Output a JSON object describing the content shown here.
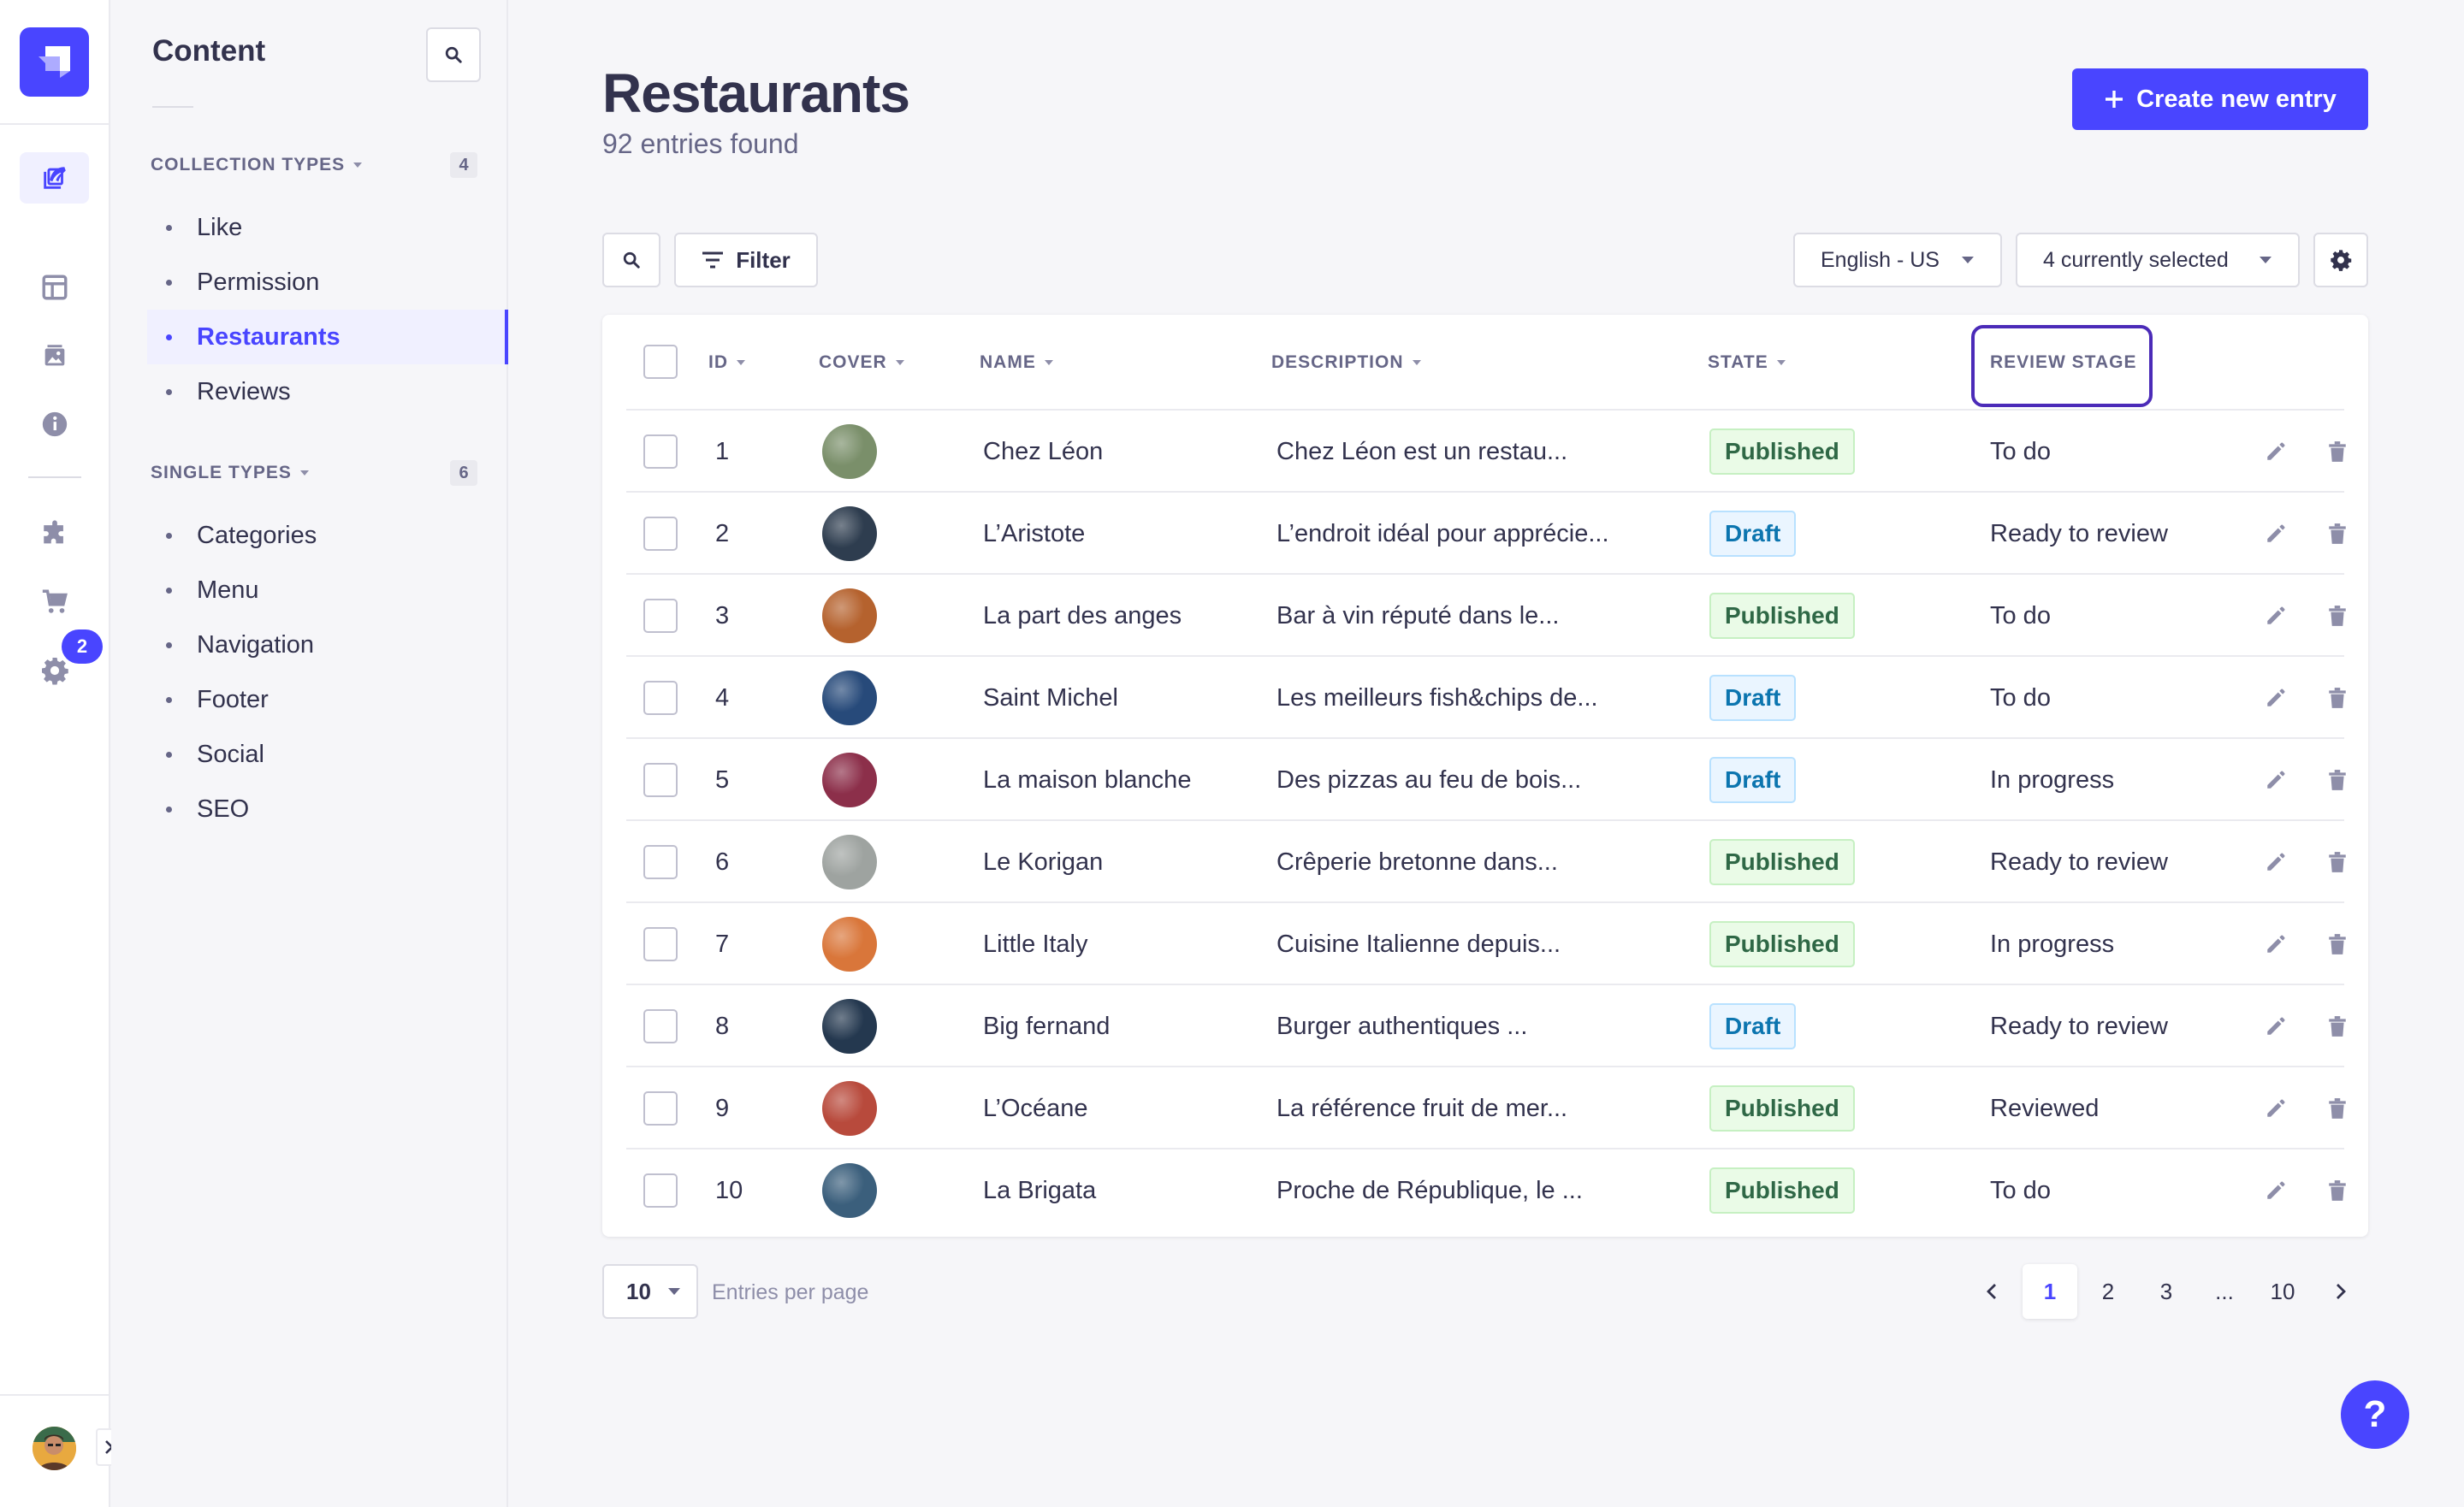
{
  "rail": {
    "badge_count": "2"
  },
  "subnav": {
    "title": "Content",
    "collection_types": {
      "label": "COLLECTION TYPES",
      "count": "4",
      "items": [
        {
          "label": "Like",
          "active": false
        },
        {
          "label": "Permission",
          "active": false
        },
        {
          "label": "Restaurants",
          "active": true
        },
        {
          "label": "Reviews",
          "active": false
        }
      ]
    },
    "single_types": {
      "label": "SINGLE TYPES",
      "count": "6",
      "items": [
        {
          "label": "Categories"
        },
        {
          "label": "Menu"
        },
        {
          "label": "Navigation"
        },
        {
          "label": "Footer"
        },
        {
          "label": "Social"
        },
        {
          "label": "SEO"
        }
      ]
    }
  },
  "header": {
    "title": "Restaurants",
    "subtitle": "92 entries found",
    "create_label": "Create new entry"
  },
  "toolbar": {
    "filter_label": "Filter",
    "locale": "English - US",
    "columns": "4 currently selected"
  },
  "table": {
    "headers": {
      "id": "ID",
      "cover": "COVER",
      "name": "NAME",
      "description": "DESCRIPTION",
      "state": "STATE",
      "review_stage": "REVIEW STAGE"
    },
    "rows": [
      {
        "id": "1",
        "name": "Chez Léon",
        "description": "Chez Léon est un restau...",
        "state": "Published",
        "review": "To do",
        "cover_color": "#7a8f6a"
      },
      {
        "id": "2",
        "name": "L’Aristote",
        "description": "L’endroit idéal pour apprécie...",
        "state": "Draft",
        "review": "Ready to review",
        "cover_color": "#2e3d4f"
      },
      {
        "id": "3",
        "name": "La part des anges",
        "description": "Bar à vin réputé dans le...",
        "state": "Published",
        "review": "To do",
        "cover_color": "#b5622e"
      },
      {
        "id": "4",
        "name": "Saint Michel",
        "description": "Les meilleurs fish&chips de...",
        "state": "Draft",
        "review": "To do",
        "cover_color": "#274a7a"
      },
      {
        "id": "5",
        "name": "La maison blanche",
        "description": "Des pizzas au feu de bois...",
        "state": "Draft",
        "review": "In progress",
        "cover_color": "#8c2f4a"
      },
      {
        "id": "6",
        "name": "Le Korigan",
        "description": "Crêperie bretonne dans...",
        "state": "Published",
        "review": "Ready to review",
        "cover_color": "#9ea3a0"
      },
      {
        "id": "7",
        "name": "Little Italy",
        "description": "Cuisine Italienne depuis...",
        "state": "Published",
        "review": "In progress",
        "cover_color": "#d9763a"
      },
      {
        "id": "8",
        "name": "Big fernand",
        "description": "Burger authentiques ...",
        "state": "Draft",
        "review": "Ready to review",
        "cover_color": "#24384f"
      },
      {
        "id": "9",
        "name": "L’Océane",
        "description": "La référence fruit de mer...",
        "state": "Published",
        "review": "Reviewed",
        "cover_color": "#b84a3c"
      },
      {
        "id": "10",
        "name": "La Brigata",
        "description": "Proche de République, le ...",
        "state": "Published",
        "review": "To do",
        "cover_color": "#3b5f7c"
      }
    ]
  },
  "pagination": {
    "per_page": "10",
    "per_page_label": "Entries per page",
    "pages": [
      "1",
      "2",
      "3",
      "...",
      "10"
    ],
    "current": "1"
  },
  "help_label": "?",
  "colors": {
    "accent": "#4945ff",
    "published": "#2f6846",
    "draft": "#0c75af",
    "highlight": "#4b2bb8"
  }
}
